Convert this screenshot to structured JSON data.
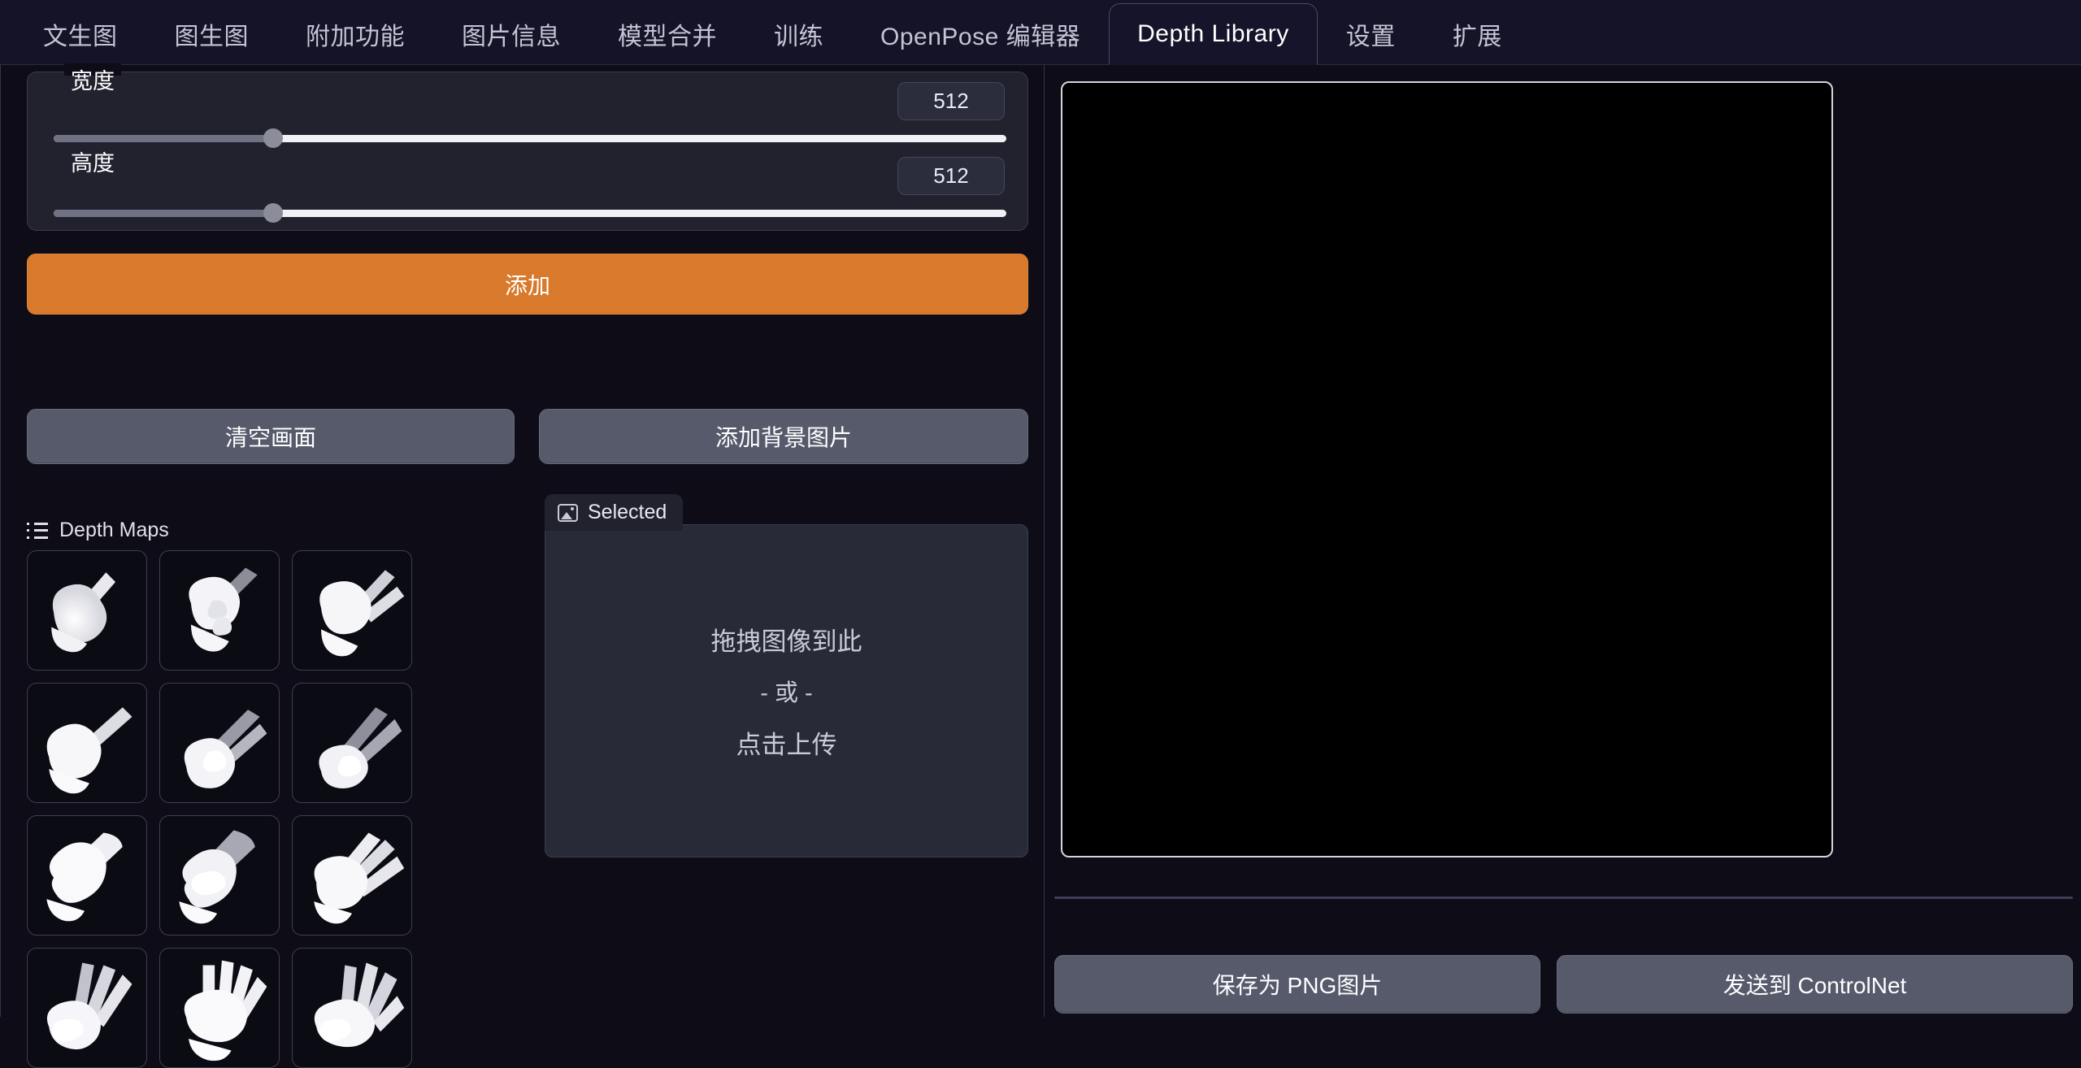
{
  "tabs": [
    {
      "label": "文生图",
      "active": false
    },
    {
      "label": "图生图",
      "active": false
    },
    {
      "label": "附加功能",
      "active": false
    },
    {
      "label": "图片信息",
      "active": false
    },
    {
      "label": "模型合并",
      "active": false
    },
    {
      "label": "训练",
      "active": false
    },
    {
      "label": "OpenPose 编辑器",
      "active": false
    },
    {
      "label": "Depth Library",
      "active": true
    },
    {
      "label": "设置",
      "active": false
    },
    {
      "label": "扩展",
      "active": false
    }
  ],
  "controls": {
    "width": {
      "label": "宽度",
      "value": "512",
      "fill_percent": 23
    },
    "height": {
      "label": "高度",
      "value": "512",
      "fill_percent": 23
    }
  },
  "buttons": {
    "add": "添加",
    "clear_canvas": "清空画面",
    "add_background_image": "添加背景图片",
    "save_png": "保存为 PNG图片",
    "send_controlnet": "发送到 ControlNet"
  },
  "depth_maps": {
    "header": "Depth Maps",
    "header_icon": "list-icon",
    "items": [
      {
        "name": "hand-point-up-1",
        "pose": "pointing-index-up"
      },
      {
        "name": "hand-point-up-2",
        "pose": "pointing-index-up-angled"
      },
      {
        "name": "hand-peace-1",
        "pose": "two-fingers-up"
      },
      {
        "name": "hand-point-diagonal",
        "pose": "pointing-diagonal"
      },
      {
        "name": "hand-peace-2",
        "pose": "two-fingers-diagonal"
      },
      {
        "name": "hand-peace-3",
        "pose": "two-fingers-spread"
      },
      {
        "name": "hand-flat-1",
        "pose": "flat-hand-angled"
      },
      {
        "name": "hand-thumb-across",
        "pose": "thumb-across-palm"
      },
      {
        "name": "hand-three-fingers",
        "pose": "three-fingers-up"
      },
      {
        "name": "hand-three-spread",
        "pose": "three-fingers-spread"
      },
      {
        "name": "hand-open-palm",
        "pose": "open-palm-four-fingers"
      },
      {
        "name": "hand-four-fingers",
        "pose": "four-fingers-spread"
      }
    ]
  },
  "selected_panel": {
    "badge_label": "Selected",
    "badge_icon": "image-icon",
    "dropzone": {
      "line1": "拖拽图像到此",
      "line2": "- 或 -",
      "line3": "点击上传"
    }
  },
  "canvas": {
    "name": "depth-canvas",
    "background": "#000000"
  },
  "colors": {
    "page_background": "#0d0c17",
    "tabbar_background": "#141327",
    "accent_orange": "#d8792c",
    "button_gray": "#565a6b",
    "panel_gray": "#22222f",
    "dropzone_gray": "#282a37",
    "text_primary": "#ffffff",
    "text_muted": "#c3c4d4"
  }
}
